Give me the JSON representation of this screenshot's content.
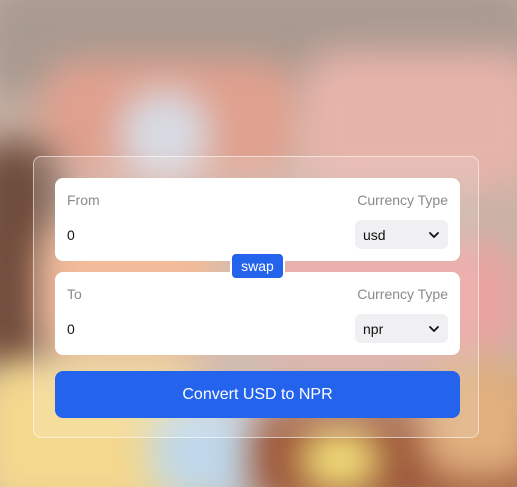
{
  "from": {
    "label": "From",
    "currency_type_label": "Currency Type",
    "amount_value": "0",
    "currency_selected": "usd"
  },
  "to": {
    "label": "To",
    "currency_type_label": "Currency Type",
    "amount_value": "0",
    "currency_selected": "npr"
  },
  "swap_label": "swap",
  "convert_label": "Convert USD to NPR",
  "colors": {
    "accent": "#2463eb",
    "card": "#ffffff",
    "muted_text": "#8a8a8a",
    "select_bg": "#f0f0f2"
  },
  "icons": {
    "select_chevron": "chevron-down-icon"
  }
}
